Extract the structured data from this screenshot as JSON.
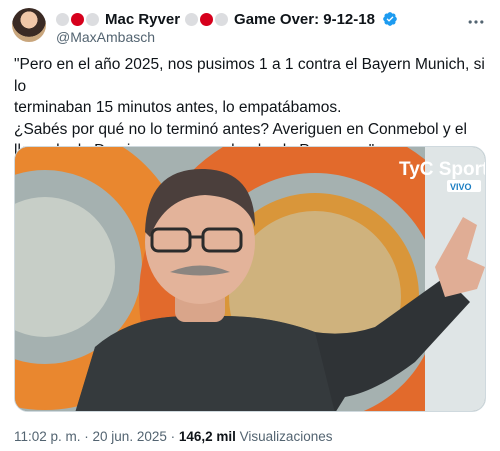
{
  "author": {
    "display_name_left": "Mac Ryver",
    "display_name_right": "Game Over: 9-12-18",
    "handle": "@MaxAmbasch"
  },
  "tweet": {
    "lines": [
      "\"Pero en el año 2025, nos pusimos 1 a 1 contra el Bayern Munich, si lo",
      "terminaban 15 minutos antes, lo empatábamos.",
      "¿Sabés por qué no lo terminó antes? Averiguen en Conmebol y el",
      "llamado de Dominguez esa noche desde Paraguay.\""
    ]
  },
  "media": {
    "broadcaster": "TyC Sports",
    "live_badge": "VIVO"
  },
  "footer": {
    "timestamp": "11:02 p. m. · 20 jun. 2025 · ",
    "views_count": "146,2 mil",
    "views_label": " Visualizaciones"
  },
  "colors": {
    "verified": "#1d9bf0",
    "text_primary": "#0f1419",
    "text_secondary": "#536471",
    "flag_red": "#d6001c"
  },
  "icons": [
    "verified-badge-icon",
    "more-options-icon"
  ]
}
